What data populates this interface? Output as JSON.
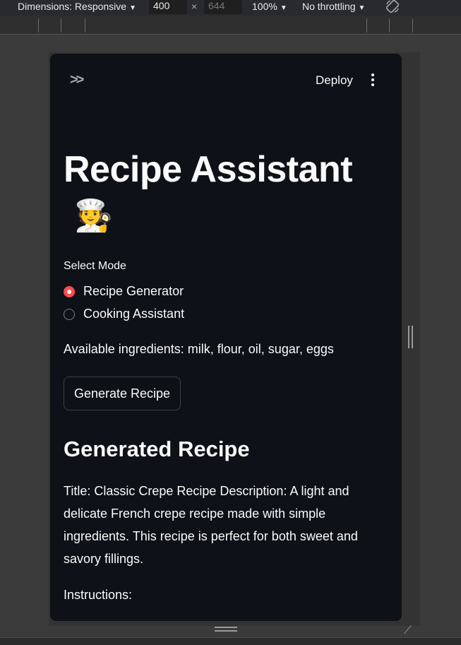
{
  "devtools": {
    "dimensions_label": "Dimensions: Responsive",
    "width_value": "400",
    "times_sign": "×",
    "height_placeholder": "644",
    "zoom": "100%",
    "throttling": "No throttling"
  },
  "app": {
    "deploy_label": "Deploy",
    "title": "Recipe Assistant",
    "title_emoji": "🧑‍🍳",
    "mode": {
      "label": "Select Mode",
      "options": [
        "Recipe Generator",
        "Cooking Assistant"
      ],
      "selected": "Recipe Generator"
    },
    "available_ingredients": "Available ingredients: milk, flour, oil, sugar, eggs",
    "generate_button": "Generate Recipe",
    "generated_heading": "Generated Recipe",
    "recipe_text": "Title: Classic Crepe Recipe Description: A light and delicate French crepe recipe made with simple ingredients. This recipe is perfect for both sweet and savory fillings.",
    "instructions_label": "Instructions:"
  },
  "colors": {
    "accent": "#ff4b4b",
    "app_background": "#0e1117",
    "text": "#fafafa"
  }
}
